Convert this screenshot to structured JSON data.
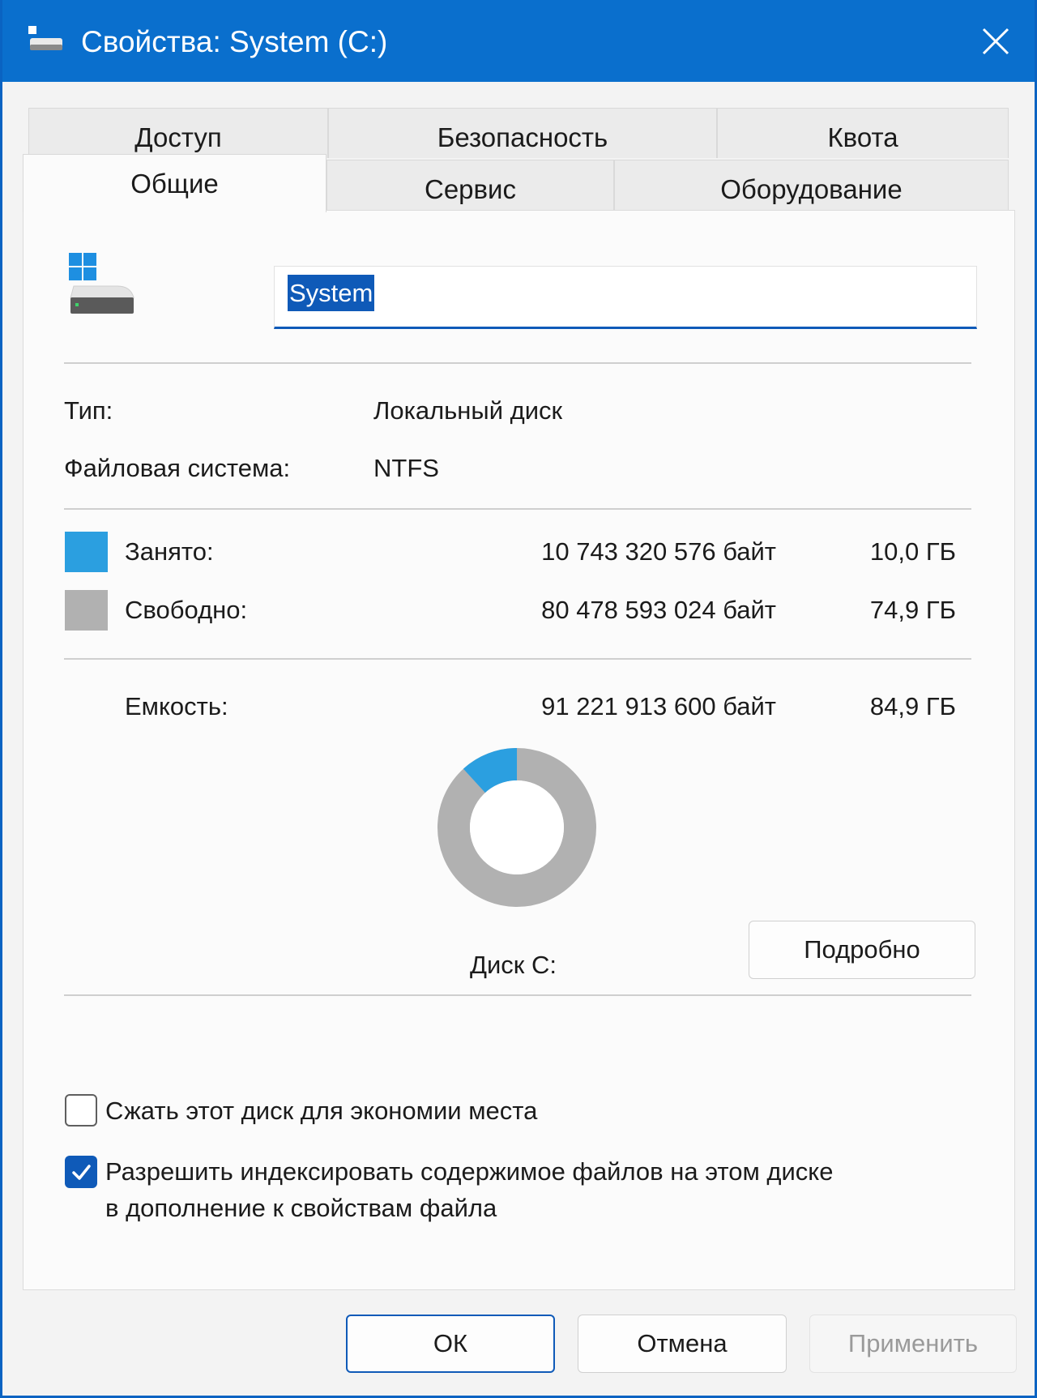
{
  "window": {
    "title": "Свойства: System (C:)"
  },
  "tabs": {
    "top_row": [
      {
        "label": "Доступ"
      },
      {
        "label": "Безопасность"
      },
      {
        "label": "Квота"
      }
    ],
    "bottom_row": [
      {
        "label": "Общие",
        "active": true
      },
      {
        "label": "Сервис"
      },
      {
        "label": "Оборудование"
      }
    ]
  },
  "drive": {
    "name": "System",
    "icon": "windows-drive-icon",
    "type_label": "Тип:",
    "type_value": "Локальный диск",
    "fs_label": "Файловая система:",
    "fs_value": "NTFS"
  },
  "usage": {
    "used": {
      "label": "Занято:",
      "bytes": "10 743 320 576 байт",
      "size": "10,0 ГБ",
      "color": "#2b9fe0"
    },
    "free": {
      "label": "Свободно:",
      "bytes": "80 478 593 024 байт",
      "size": "74,9 ГБ",
      "color": "#b1b1b1"
    },
    "capacity": {
      "label": "Емкость:",
      "bytes": "91 221 913 600 байт",
      "size": "84,9 ГБ"
    },
    "used_fraction": 0.1178
  },
  "disk_label": "Диск C:",
  "details_button": "Подробно",
  "options": {
    "compress": {
      "label": "Сжать этот диск для экономии места",
      "checked": false
    },
    "index": {
      "line1": "Разрешить индексировать содержимое файлов на этом диске",
      "line2": "в дополнение к свойствам файла",
      "checked": true
    }
  },
  "buttons": {
    "ok": "ОК",
    "cancel": "Отмена",
    "apply": "Применить"
  },
  "colors": {
    "accent": "#0a6fcd",
    "selection": "#0f5ab8"
  }
}
